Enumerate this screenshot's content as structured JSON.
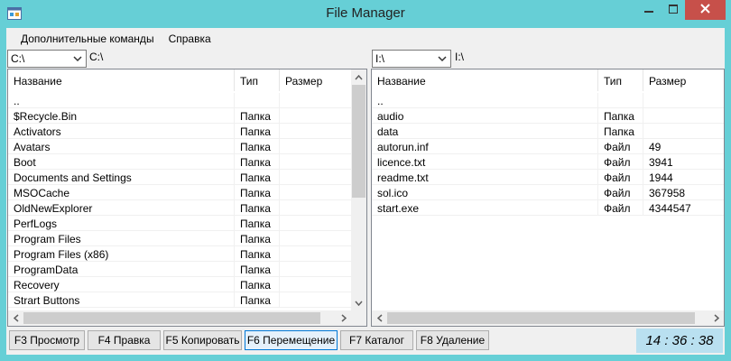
{
  "window": {
    "title": "File Manager"
  },
  "menu": [
    "Дополнительные команды",
    "Справка"
  ],
  "left": {
    "drive": "C:\\",
    "path": "C:\\",
    "columns": [
      "Название",
      "Тип",
      "Размер"
    ],
    "rows": [
      [
        "..",
        "",
        ""
      ],
      [
        "$Recycle.Bin",
        "Папка",
        ""
      ],
      [
        "Activators",
        "Папка",
        ""
      ],
      [
        "Avatars",
        "Папка",
        ""
      ],
      [
        "Boot",
        "Папка",
        ""
      ],
      [
        "Documents and Settings",
        "Папка",
        ""
      ],
      [
        "MSOCache",
        "Папка",
        ""
      ],
      [
        "OldNewExplorer",
        "Папка",
        ""
      ],
      [
        "PerfLogs",
        "Папка",
        ""
      ],
      [
        "Program Files",
        "Папка",
        ""
      ],
      [
        "Program Files (x86)",
        "Папка",
        ""
      ],
      [
        "ProgramData",
        "Папка",
        ""
      ],
      [
        "Recovery",
        "Папка",
        ""
      ],
      [
        "Strart Buttons",
        "Папка",
        ""
      ]
    ]
  },
  "right": {
    "drive": "I:\\",
    "path": "I:\\",
    "columns": [
      "Название",
      "Тип",
      "Размер"
    ],
    "rows": [
      [
        "..",
        "",
        ""
      ],
      [
        "audio",
        "Папка",
        ""
      ],
      [
        "data",
        "Папка",
        ""
      ],
      [
        "autorun.inf",
        "Файл",
        "49"
      ],
      [
        "licence.txt",
        "Файл",
        "3941"
      ],
      [
        "readme.txt",
        "Файл",
        "1944"
      ],
      [
        "sol.ico",
        "Файл",
        "367958"
      ],
      [
        "start.exe",
        "Файл",
        "4344547"
      ]
    ]
  },
  "fkeys": [
    "F3 Просмотр",
    "F4 Правка",
    "F5 Копировать",
    "F6 Перемещение",
    "F7 Каталог",
    "F8 Удаление"
  ],
  "clock": "14 : 36 : 38",
  "colors": {
    "frame": "#66cfd6",
    "close": "#c7504a",
    "clock_bg": "#b9e0f0",
    "focus": "#0078d7"
  }
}
